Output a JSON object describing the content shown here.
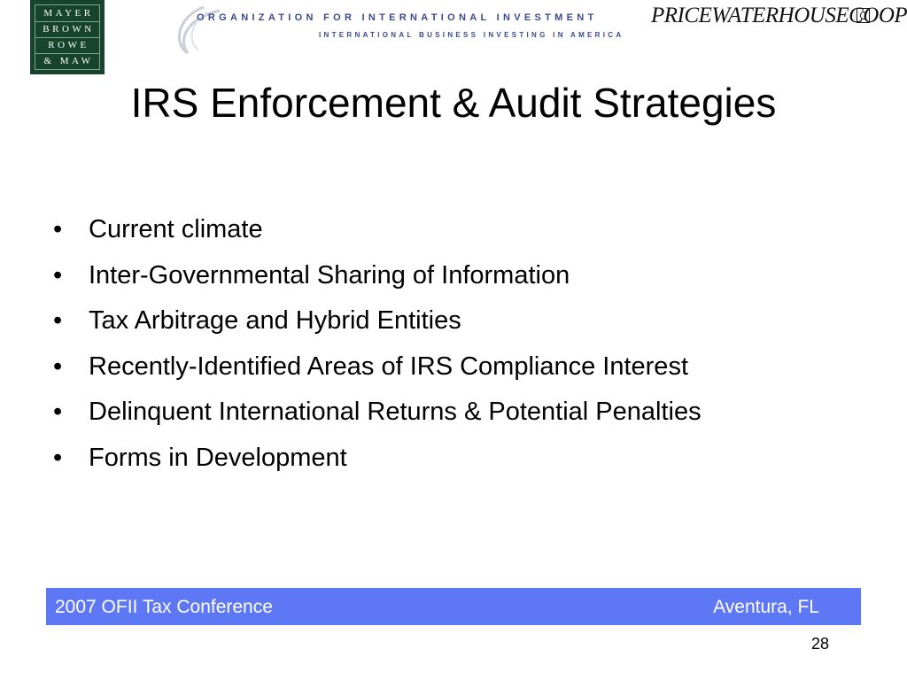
{
  "header": {
    "mayer_brown_logo": [
      "MAYER",
      "BROWN",
      "ROWE",
      "& MAW"
    ],
    "ofii_logo": {
      "line1": "ORGANIZATION FOR INTERNATIONAL INVESTMENT",
      "line2": "INTERNATIONAL BUSINESS INVESTING IN AMERICA"
    },
    "pwc_logo": "PRICEWATERHOUSECOOPERS"
  },
  "title": "IRS Enforcement & Audit Strategies",
  "bullets": [
    "Current climate",
    "Inter-Governmental Sharing of Information",
    "Tax Arbitrage and Hybrid Entities",
    "Recently-Identified Areas of IRS Compliance Interest",
    "Delinquent International Returns & Potential Penalties",
    "Forms in Development"
  ],
  "bullet_symbol": "•",
  "footer": {
    "left": "2007 OFII Tax Conference",
    "right": "Aventura, FL"
  },
  "page_number": "28",
  "colors": {
    "footer_bar": "#5e78f5",
    "mayer_brown_green": "#16442c",
    "ofii_blue": "#3a4a8c"
  },
  "icons": {
    "pwc_mark": "pwc-trademark-icon",
    "ofii_swoosh": "swoosh-icon"
  }
}
